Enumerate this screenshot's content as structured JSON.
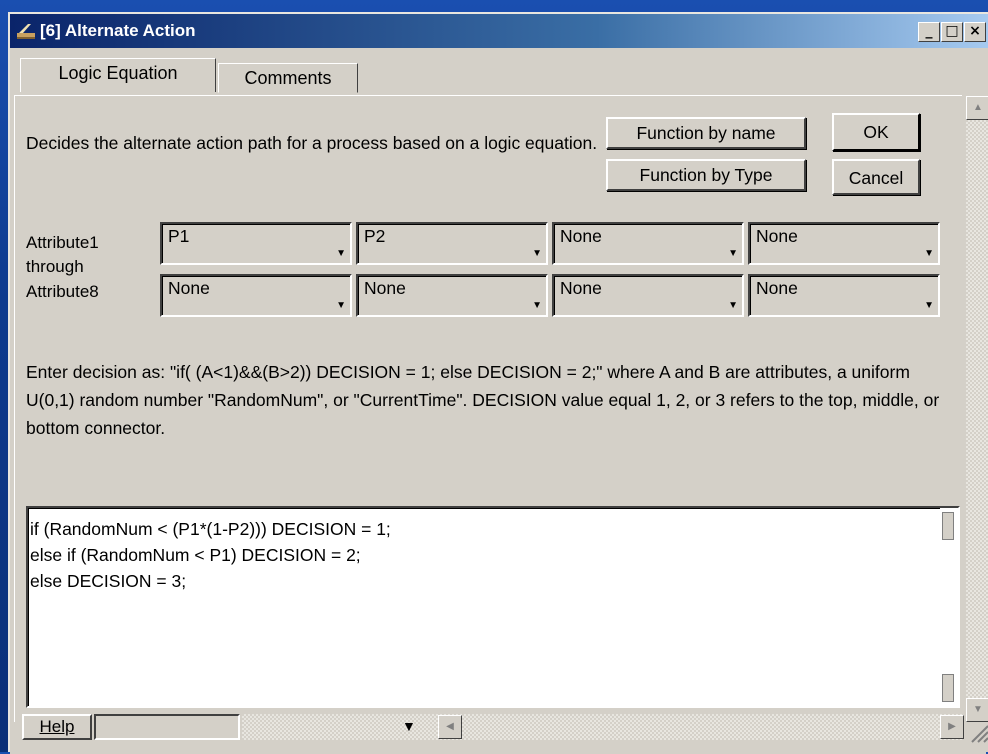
{
  "window": {
    "title": "[6]  Alternate Action",
    "minimize_glyph": "_",
    "maximize_glyph": "□",
    "close_glyph": "×"
  },
  "tabs": [
    {
      "label": "Logic Equation",
      "active": true
    },
    {
      "label": "Comments",
      "active": false
    }
  ],
  "description": "Decides the alternate action path for a process based on a logic equation.",
  "buttons": {
    "function_by_name": "Function by name",
    "function_by_type": "Function by Type",
    "ok": "OK",
    "cancel": "Cancel"
  },
  "attributes": {
    "label_line1": "Attribute1",
    "label_line2": "through",
    "label_line3": "Attribute8",
    "values": [
      "P1",
      "P2",
      "None",
      "None",
      "None",
      "None",
      "None",
      "None"
    ]
  },
  "instructions": "Enter decision as: \"if( (A<1)&&(B>2))   DECISION = 1;  else DECISION = 2;\"  where A and B are attributes, a uniform U(0,1) random number \"RandomNum\", or \"CurrentTime\".   DECISION value equal 1, 2, or 3 refers to the top, middle, or bottom connector.",
  "code": [
    "if (RandomNum < (P1*(1-P2))) DECISION = 1;",
    "else if (RandomNum < P1) DECISION = 2;",
    "else DECISION = 3;"
  ],
  "status_bar": {
    "help_label": "Help",
    "status_text": ""
  },
  "colors": {
    "desktop": "#1a4fb0",
    "titlebar_start": "#0a246a",
    "titlebar_end": "#a6caf0",
    "face": "#d4d0c8"
  }
}
